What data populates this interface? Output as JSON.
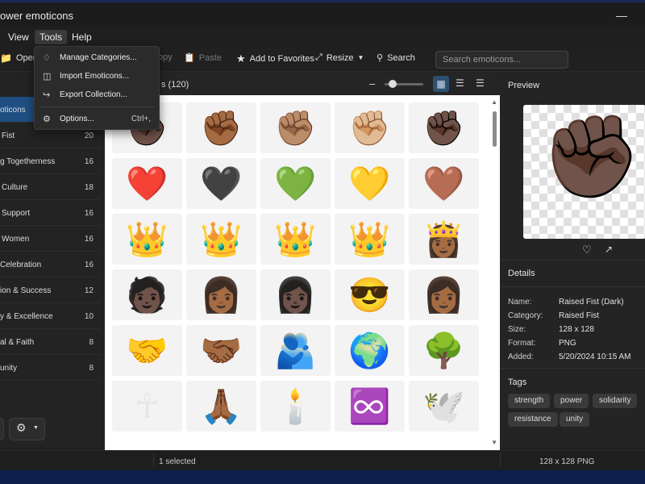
{
  "title": "ower emoticons",
  "menu": [
    "View",
    "Tools",
    "Help"
  ],
  "toolbar": {
    "open": "Open",
    "copy": "opy",
    "paste": "Paste",
    "favorites": "Add to Favorites",
    "resize": "Resize",
    "search": "Search",
    "search_placeholder": "Search emoticons..."
  },
  "dropdown": [
    {
      "label": "Manage Categories...",
      "icon": "tag-icon",
      "shortcut": ""
    },
    {
      "label": "Import Emoticons...",
      "icon": "import-icon",
      "shortcut": ""
    },
    {
      "label": "Export Collection...",
      "icon": "export-icon",
      "shortcut": ""
    },
    {
      "label": "Options...",
      "icon": "gear-icon",
      "shortcut": "Ctrl+,"
    }
  ],
  "categories": [
    {
      "name": "oticons",
      "count": ""
    },
    {
      "name": "Fist",
      "count": "20"
    },
    {
      "name": "g Togetherness",
      "count": "16"
    },
    {
      "name": "Culture",
      "count": "18"
    },
    {
      "name": "Support",
      "count": "16"
    },
    {
      "name": "Women",
      "count": "16"
    },
    {
      "name": "Celebration",
      "count": "16"
    },
    {
      "name": "ion & Success",
      "count": "12"
    },
    {
      "name": "y & Excellence",
      "count": "10"
    },
    {
      "name": "al & Faith",
      "count": "8"
    },
    {
      "name": "unity",
      "count": "8"
    }
  ],
  "grid_header": {
    "count": "s (120)"
  },
  "emoticons": [
    [
      "✊🏿",
      "✊🏾",
      "✊🏽",
      "✊🏼",
      "✊🏿"
    ],
    [
      "❤️",
      "🖤",
      "💚",
      "💛",
      "🤎"
    ],
    [
      "👑",
      "👑",
      "👑",
      "👑",
      "👸🏾"
    ],
    [
      "🧑🏿",
      "👩🏾",
      "👩🏿",
      "😎",
      "👩🏾"
    ],
    [
      "🤝",
      "🤝🏾",
      "🫂",
      "🌍",
      "🌳"
    ],
    [
      "☥",
      "🙏🏾",
      "🕯️",
      "♾️",
      "🕊️"
    ]
  ],
  "preview": {
    "title": "Preview",
    "image": "✊🏿"
  },
  "details": {
    "title": "Details",
    "rows": [
      {
        "key": "Name:",
        "value": "Raised Fist (Dark)"
      },
      {
        "key": "Category:",
        "value": "Raised Fist"
      },
      {
        "key": "Size:",
        "value": "128 x 128"
      },
      {
        "key": "Format:",
        "value": "PNG"
      },
      {
        "key": "Added:",
        "value": "5/20/2024  10:15 AM"
      }
    ]
  },
  "tags": {
    "title": "Tags",
    "items": [
      "strength",
      "power",
      "solidarity",
      "resistance",
      "unity"
    ]
  },
  "status": {
    "left": "1 selected",
    "right": "128 x 128 PNG"
  },
  "colors": {
    "accent": "#1f4f82",
    "background": "#202020"
  }
}
